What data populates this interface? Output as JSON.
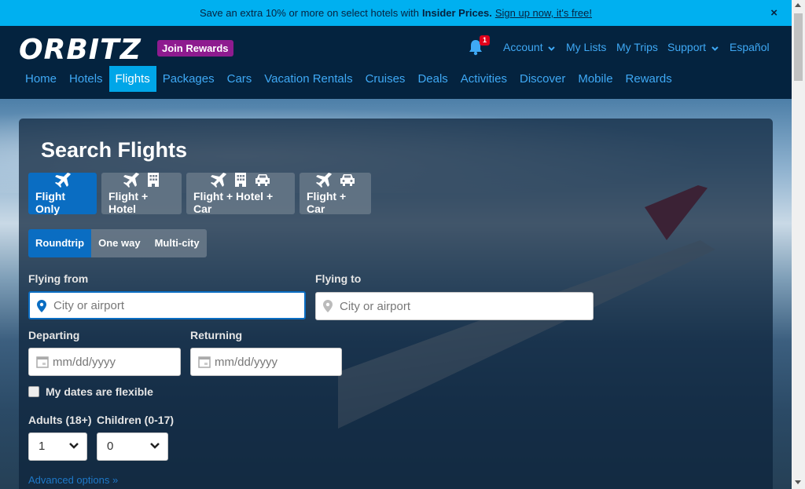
{
  "promo": {
    "text": "Save an extra 10% or more on select hotels with",
    "bold": "Insider Prices.",
    "link": "Sign up now, it's free!",
    "close": "×"
  },
  "header": {
    "logo": "ORBITZ",
    "join_rewards": "Join Rewards",
    "notification_count": "1",
    "account": "Account",
    "my_lists": "My Lists",
    "my_trips": "My Trips",
    "support": "Support",
    "language": "Español"
  },
  "nav": [
    "Home",
    "Hotels",
    "Flights",
    "Packages",
    "Cars",
    "Vacation Rentals",
    "Cruises",
    "Deals",
    "Activities",
    "Discover",
    "Mobile",
    "Rewards"
  ],
  "search": {
    "title": "Search Flights",
    "product_tabs": [
      "Flight Only",
      "Flight + Hotel",
      "Flight + Hotel + Car",
      "Flight + Car"
    ],
    "trip_types": [
      "Roundtrip",
      "One way",
      "Multi-city"
    ],
    "flying_from_label": "Flying from",
    "flying_from_placeholder": "City or airport",
    "flying_to_label": "Flying to",
    "flying_to_placeholder": "City or airport",
    "departing_label": "Departing",
    "departing_placeholder": "mm/dd/yyyy",
    "returning_label": "Returning",
    "returning_placeholder": "mm/dd/yyyy",
    "flexible_label": "My dates are flexible",
    "adults_label": "Adults (18+)",
    "adults_value": "1",
    "children_label": "Children (0-17)",
    "children_value": "0",
    "advanced": "Advanced options"
  },
  "colors": {
    "promo_bg": "#00b0f0",
    "header_bg": "#04233f",
    "nav_active": "#00a6e8",
    "tab_active": "#0a6dc2",
    "join_bg": "#8e1b8f",
    "badge": "#e0001b"
  }
}
